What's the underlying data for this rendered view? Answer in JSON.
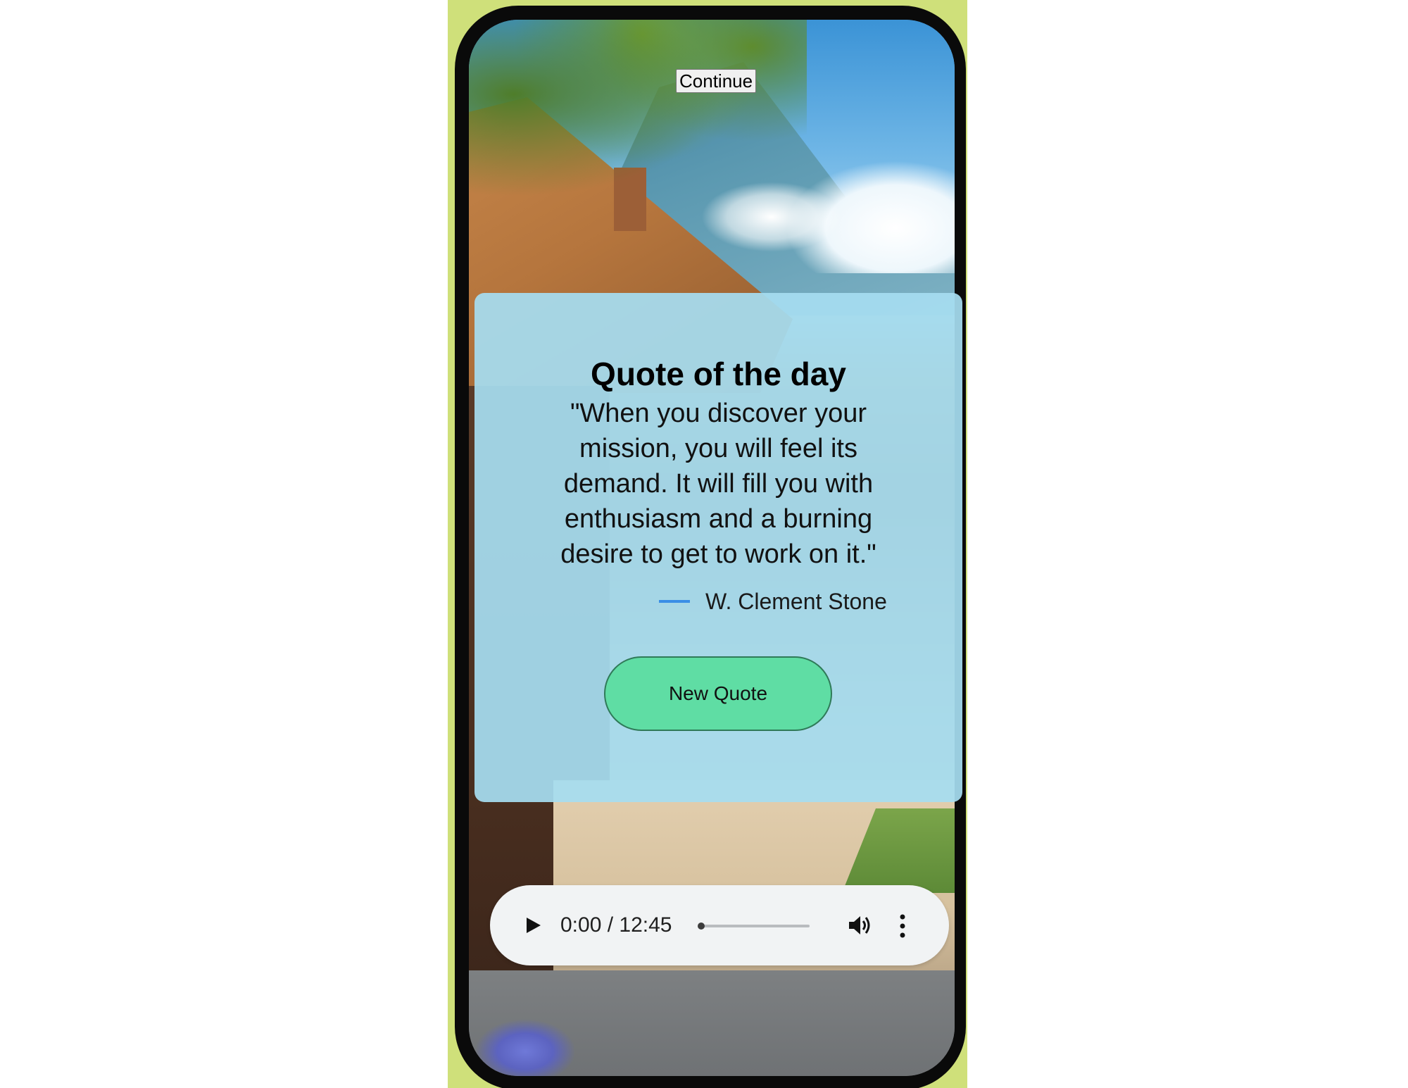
{
  "top_button": {
    "label": "Continue"
  },
  "quote_card": {
    "title": "Quote of the day",
    "quote": "\"When you discover your mission, you will feel its demand. It will fill you with enthusiasm and a burning desire to get to work on it.\"",
    "author": "W. Clement Stone",
    "new_quote_label": "New Quote"
  },
  "audio": {
    "time": "0:00 / 12:45",
    "progress": 0,
    "icons": {
      "play": "play-icon",
      "volume": "volume-icon",
      "more": "more-vertical-icon"
    }
  },
  "colors": {
    "card_background": "#a6ddf0",
    "button_fill": "#5fdda4",
    "button_border": "#2f7a58",
    "author_dash": "#3b8ee6",
    "backdrop": "#cfe07a"
  }
}
